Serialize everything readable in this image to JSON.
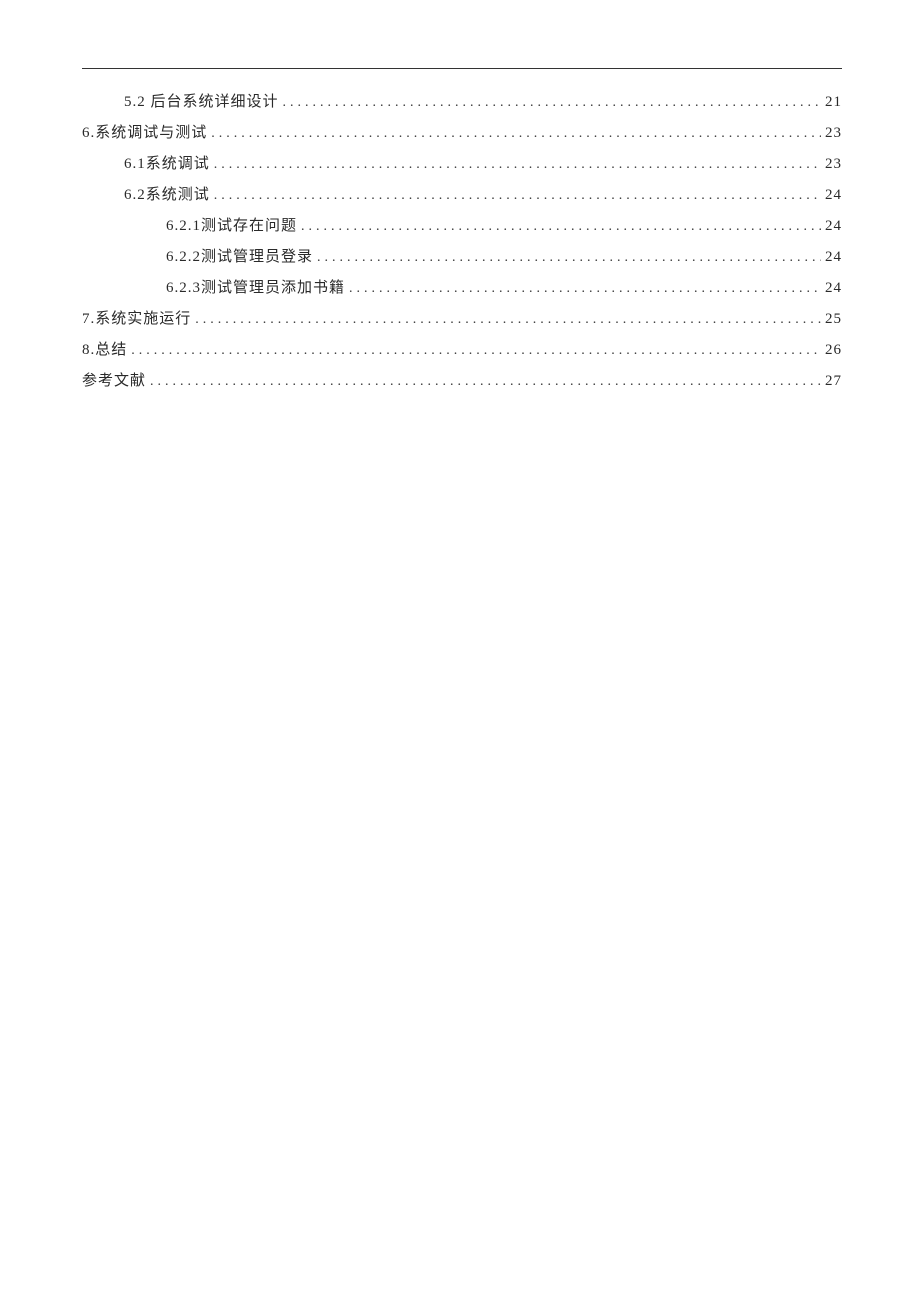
{
  "toc": [
    {
      "level": 1,
      "label": "5.2 后台系统详细设计",
      "page": "21"
    },
    {
      "level": 0,
      "label": "6.系统调试与测试",
      "page": "23"
    },
    {
      "level": 1,
      "label": "6.1系统调试",
      "page": "23"
    },
    {
      "level": 1,
      "label": "6.2系统测试",
      "page": "24"
    },
    {
      "level": 2,
      "label": "6.2.1测试存在问题",
      "page": "24"
    },
    {
      "level": 2,
      "label": "6.2.2测试管理员登录",
      "page": "24"
    },
    {
      "level": 2,
      "label": "6.2.3测试管理员添加书籍",
      "page": "24"
    },
    {
      "level": 0,
      "label": "7.系统实施运行",
      "page": "25"
    },
    {
      "level": 0,
      "label": "8.总结",
      "page": "26"
    },
    {
      "level": 0,
      "label": "参考文献",
      "page": "27"
    }
  ]
}
